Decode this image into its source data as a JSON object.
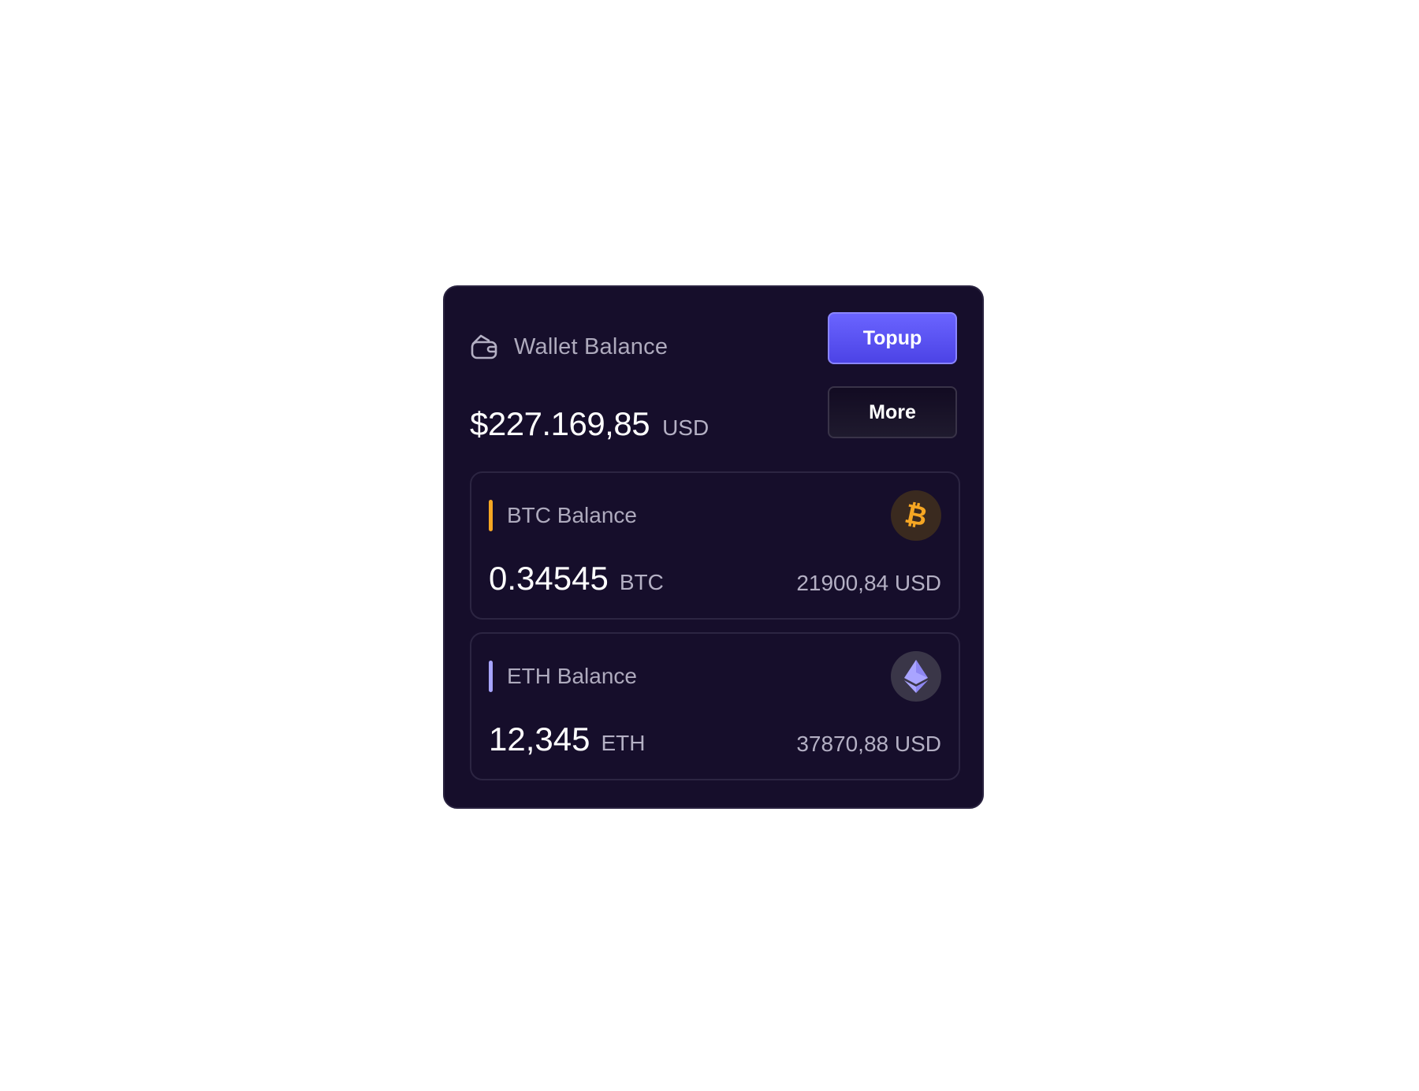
{
  "wallet": {
    "title": "Wallet Balance",
    "total_amount": "$227.169,85",
    "total_currency": "USD",
    "icon": "wallet-icon"
  },
  "actions": {
    "topup_label": "Topup",
    "more_label": "More"
  },
  "assets": [
    {
      "title": "BTC Balance",
      "amount": "0.34545",
      "unit": "BTC",
      "usd_value": "21900,84 USD",
      "accent_color": "#f5a623",
      "icon": "bitcoin-icon"
    },
    {
      "title": "ETH Balance",
      "amount": "12,345",
      "unit": "ETH",
      "usd_value": "37870,88 USD",
      "accent_color": "#a7a4ff",
      "icon": "ethereum-icon"
    }
  ],
  "colors": {
    "card_background": "#160e2b",
    "primary_button": "#5b54f5",
    "btc_badge": "#3a2a1f",
    "eth_badge": "#3a3648"
  }
}
